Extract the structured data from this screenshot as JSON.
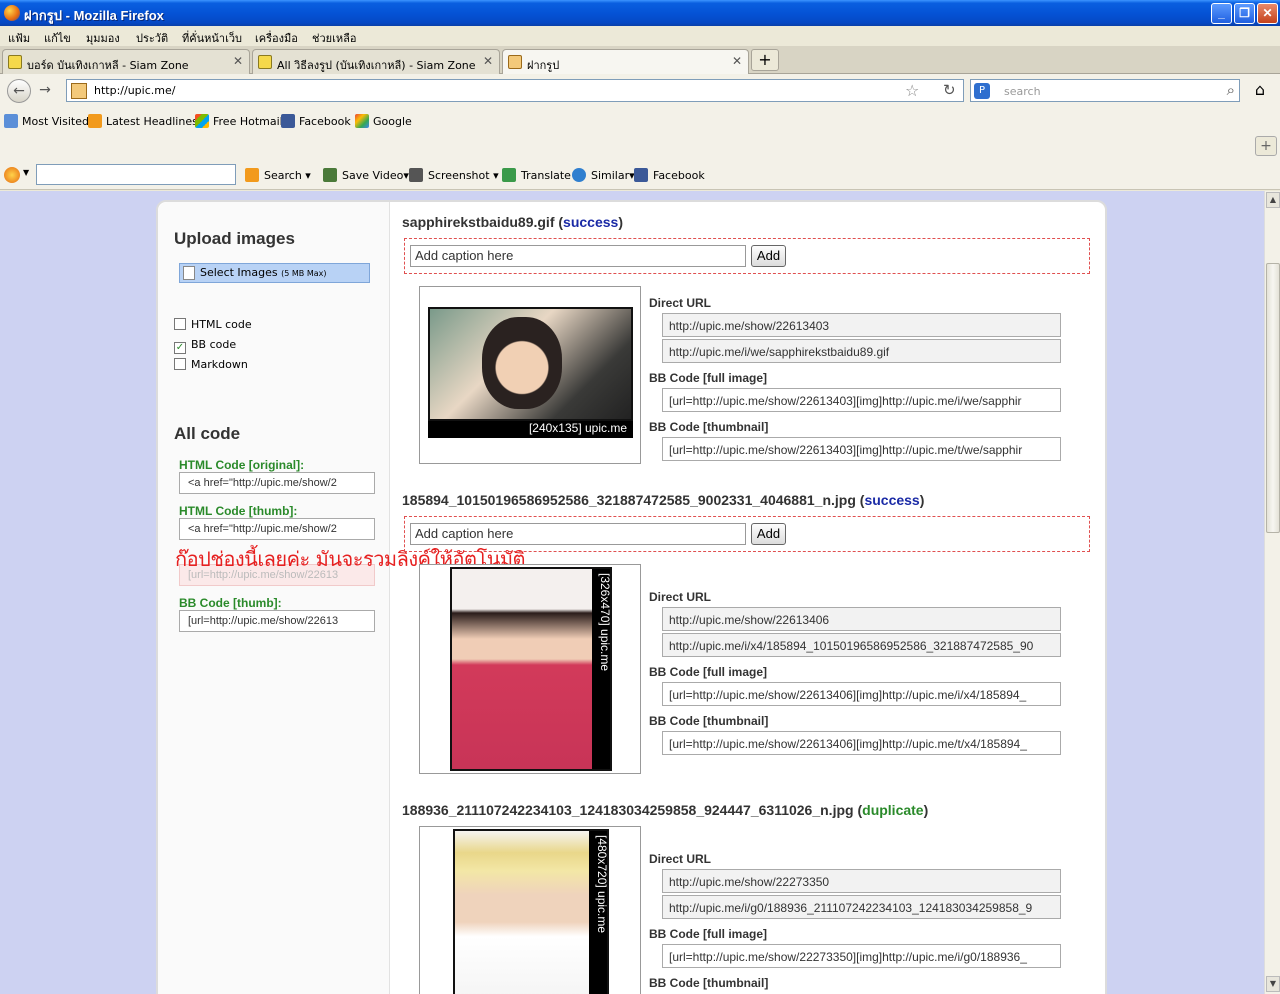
{
  "window": {
    "title": "ฝากรูป - Mozilla Firefox"
  },
  "menu": [
    "แฟ้ม",
    "แก้ไข",
    "มุมมอง",
    "ประวัติ",
    "ที่คั่นหน้าเว็บ",
    "เครื่องมือ",
    "ช่วยเหลือ"
  ],
  "tabs": [
    {
      "label": "บอร์ด บันเทิงเกาหลี - Siam Zone",
      "active": false
    },
    {
      "label": "All วิธีลงรูป (บันเทิงเกาหลี) - Siam Zone",
      "active": false
    },
    {
      "label": "ฝากรูป",
      "active": true
    }
  ],
  "nav": {
    "url": "http://upic.me/",
    "search_placeholder": "search"
  },
  "bookmarks": [
    "Most Visited",
    "Latest Headlines",
    "Free Hotmail",
    "Facebook",
    "Google"
  ],
  "toolbar": {
    "items": [
      "Search",
      "Save Video",
      "Screenshot",
      "Translate",
      "Similar",
      "Facebook"
    ]
  },
  "sidebar": {
    "upload_title": "Upload images",
    "select_button": "Select Images",
    "select_limit": "(5 MB Max)",
    "options": [
      {
        "label": "HTML code",
        "checked": false
      },
      {
        "label": "BB code",
        "checked": true
      },
      {
        "label": "Markdown",
        "checked": false
      }
    ],
    "all_code_title": "All code",
    "codes": [
      {
        "label": "HTML Code [original]:",
        "value": "<a href=\"http://upic.me/show/2"
      },
      {
        "label": "HTML Code [thumb]:",
        "value": "<a href=\"http://upic.me/show/2"
      },
      {
        "label": "",
        "value": "[url=http://upic.me/show/22613"
      },
      {
        "label": "BB Code [thumb]:",
        "value": "[url=http://upic.me/show/22613"
      }
    ],
    "overlay_note": "ก๊อปช่องนี้เลยค่ะ มันจะรวมลิงค์ให้อัตโนมัติ"
  },
  "labels": {
    "caption_placeholder": "Add caption here",
    "add_button": "Add",
    "direct_url": "Direct URL",
    "bb_full": "BB Code [full image]",
    "bb_thumb": "BB Code [thumbnail]"
  },
  "uploads": [
    {
      "filename": "sapphirekstbaidu89.gif",
      "status": "success",
      "thumb_caption": "[240x135] upic.me",
      "direct_show": "http://upic.me/show/22613403",
      "direct_img": "http://upic.me/i/we/sapphirekstbaidu89.gif",
      "bb_full": "[url=http://upic.me/show/22613403][img]http://upic.me/i/we/sapphir",
      "bb_thumb": "[url=http://upic.me/show/22613403][img]http://upic.me/t/we/sapphir"
    },
    {
      "filename": "185894_10150196586952586_321887472585_9002331_4046881_n.jpg",
      "status": "success",
      "thumb_caption": "[326x470] upic.me",
      "direct_show": "http://upic.me/show/22613406",
      "direct_img": "http://upic.me/i/x4/185894_10150196586952586_321887472585_90",
      "bb_full": "[url=http://upic.me/show/22613406][img]http://upic.me/i/x4/185894_",
      "bb_thumb": "[url=http://upic.me/show/22613406][img]http://upic.me/t/x4/185894_"
    },
    {
      "filename": "188936_211107242234103_124183034259858_924447_6311026_n.jpg",
      "status": "duplicate",
      "thumb_caption": "[480x720] upic.me",
      "direct_show": "http://upic.me/show/22273350",
      "direct_img": "http://upic.me/i/g0/188936_211107242234103_124183034259858_9",
      "bb_full": "[url=http://upic.me/show/22273350][img]http://upic.me/i/g0/188936_",
      "bb_thumb": ""
    }
  ],
  "colors": {
    "success": "#1a2aa6",
    "duplicate": "#2a8a2a",
    "page_bg": "#cdd2f2",
    "overlay_note": "#e62020"
  }
}
